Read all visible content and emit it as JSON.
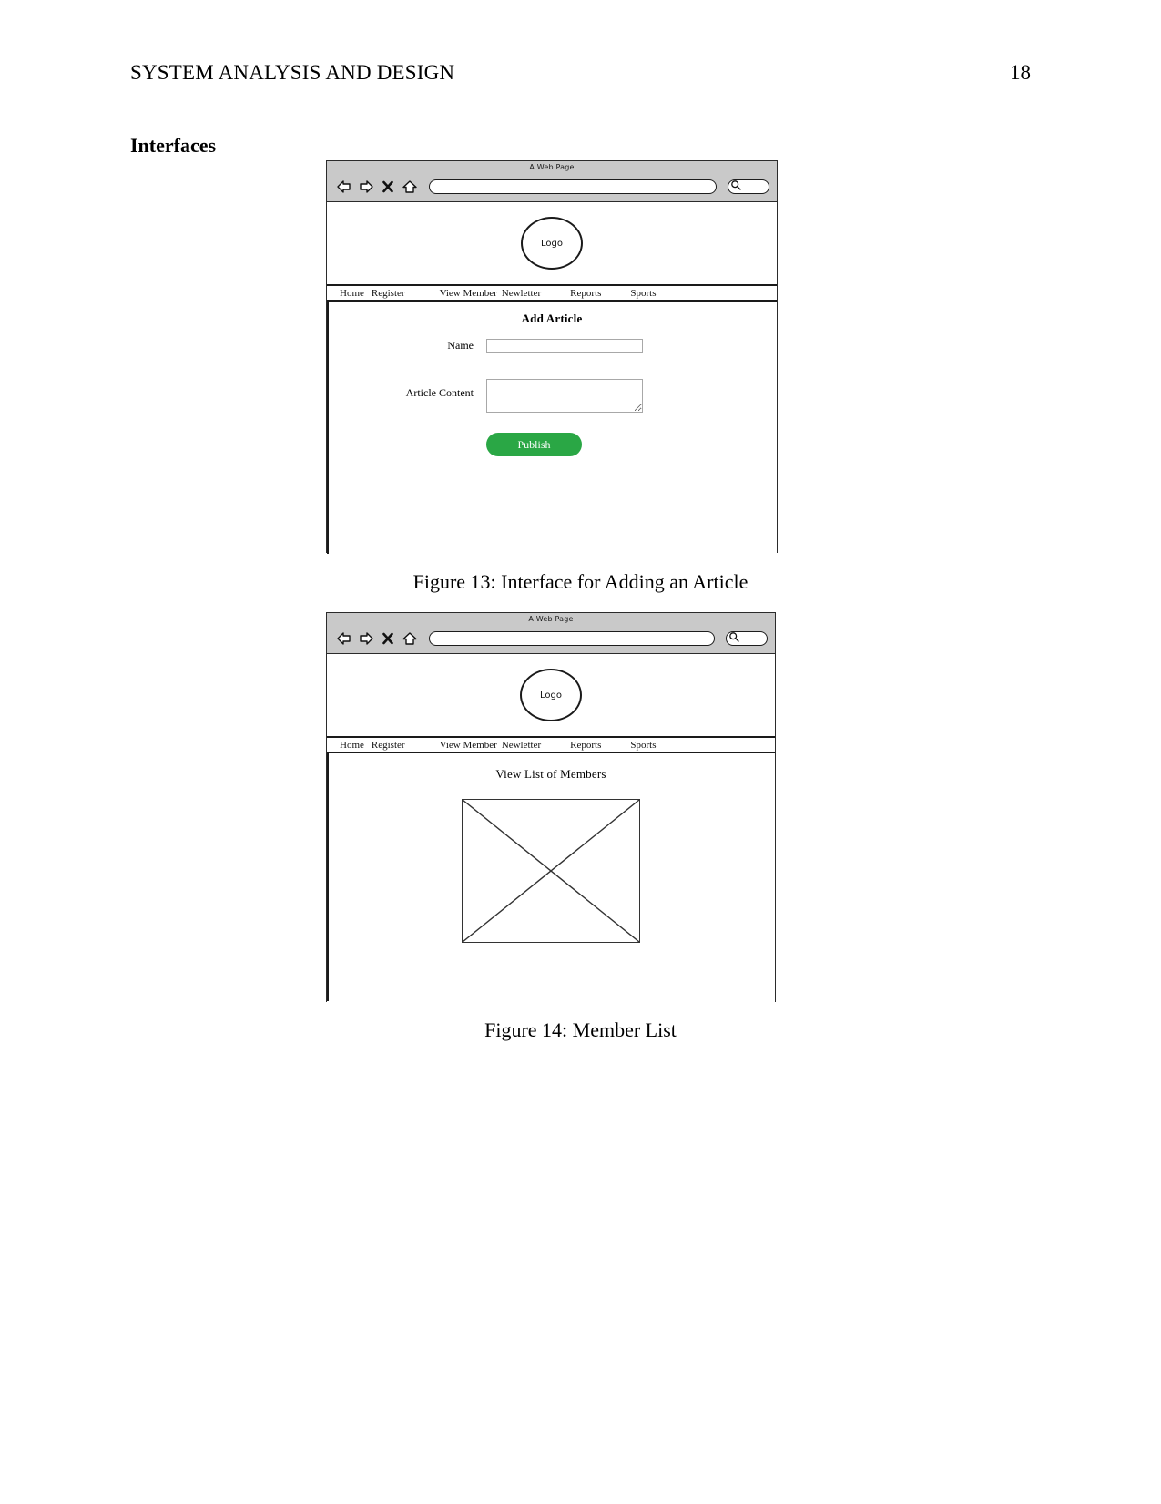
{
  "document": {
    "running_head": "SYSTEM ANALYSIS AND DESIGN",
    "page_number": "18",
    "section_heading": "Interfaces"
  },
  "figures": [
    {
      "caption": "Figure 13: Interface for Adding an Article",
      "browser": {
        "title": "A Web Page",
        "back_icon": "back-arrow-icon",
        "forward_icon": "forward-arrow-icon",
        "close_icon": "close-x-icon",
        "home_icon": "home-icon",
        "url_value": "",
        "url_placeholder": "",
        "search_value": "",
        "search_icon": "search-magnifier-icon"
      },
      "logo_label": "Logo",
      "nav_items": [
        "Home",
        "Register",
        "View Member",
        "Newletter",
        "Reports",
        "Sports"
      ],
      "form": {
        "title": "Add Article",
        "fields": [
          {
            "label": "Name",
            "value": "",
            "placeholder": "",
            "type": "text"
          },
          {
            "label": "Article Content",
            "value": "",
            "placeholder": "",
            "type": "textarea"
          }
        ],
        "submit_label": "Publish",
        "submit_color": "#2aa745"
      }
    },
    {
      "caption": "Figure 14: Member List",
      "browser": {
        "title": "A Web Page",
        "back_icon": "back-arrow-icon",
        "forward_icon": "forward-arrow-icon",
        "close_icon": "close-x-icon",
        "home_icon": "home-icon",
        "url_value": "",
        "url_placeholder": "",
        "search_value": "",
        "search_icon": "search-magnifier-icon"
      },
      "logo_label": "Logo",
      "nav_items": [
        "Home",
        "Register",
        "View Member",
        "Newletter",
        "Reports",
        "Sports"
      ],
      "content": {
        "title": "View List of Members",
        "placeholder_image": "image-placeholder"
      }
    }
  ]
}
